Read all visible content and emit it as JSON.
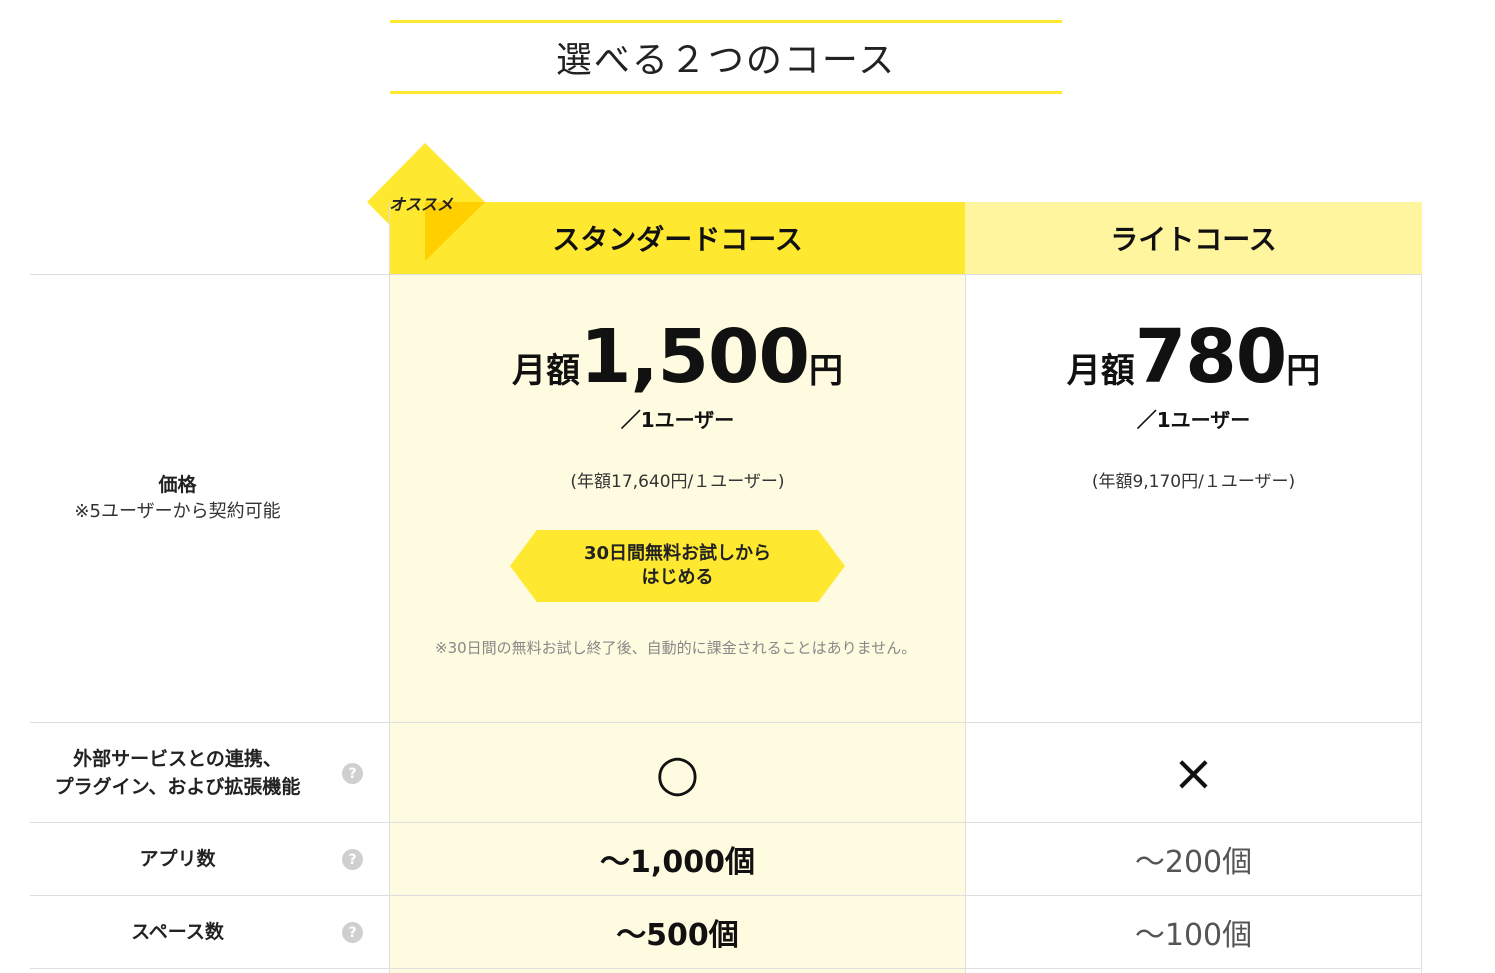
{
  "heading": "選べる２つのコース",
  "badge": "オススメ",
  "courses": {
    "standard": {
      "name": "スタンダードコース"
    },
    "lite": {
      "name": "ライトコース"
    }
  },
  "price_row": {
    "label": "価格",
    "note": "※5ユーザーから契約可能",
    "standard": {
      "prefix": "月額",
      "amount": "1,500",
      "yen": "円",
      "per_user": "／1ユーザー",
      "annual": "(年額17,640円/１ユーザー)",
      "cta_line1": "30日間無料お試しから",
      "cta_line2": "はじめる",
      "trial_note": "※30日間の無料お試し終了後、自動的に課金されることはありません。"
    },
    "lite": {
      "prefix": "月額",
      "amount": "780",
      "yen": "円",
      "per_user": "／1ユーザー",
      "annual": "(年額9,170円/１ユーザー)"
    }
  },
  "features": [
    {
      "label_line1": "外部サービスとの連携、",
      "label_line2": "プラグイン、および拡張機能",
      "standard": "○",
      "lite": "×"
    },
    {
      "label_line1": "アプリ数",
      "standard": "～1,000個",
      "lite": "～200個"
    },
    {
      "label_line1": "スペース数",
      "standard": "～500個",
      "lite": "～100個"
    }
  ],
  "help_icon": "?",
  "colors": {
    "accent": "#ffe930",
    "accent_light": "#fff59e",
    "standard_bg": "#fffbe0",
    "badge_dark": "#ffcf00"
  }
}
